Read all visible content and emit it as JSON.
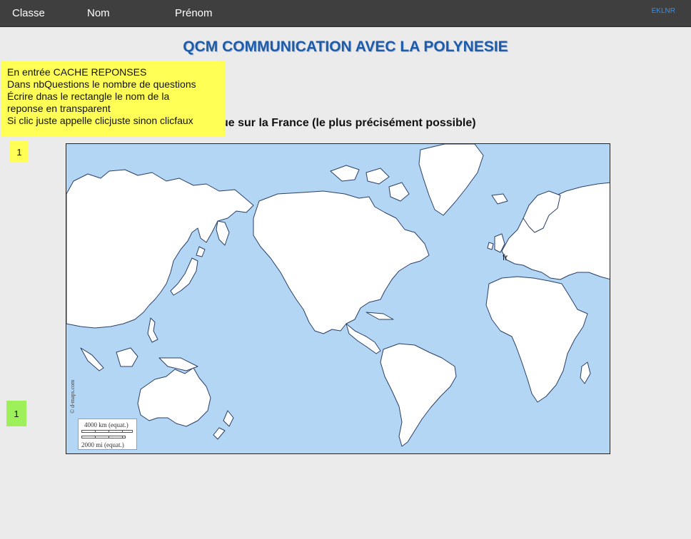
{
  "header": {
    "fields": [
      "Classe",
      "Nom",
      "Prénom"
    ],
    "code": "EKLNR"
  },
  "title": "QCM COMMUNICATION AVEC LA POLYNESIE",
  "note": {
    "lines": [
      "En entrée CACHE REPONSES",
      "Dans nbQuestions le nombre de questions",
      "Écrire dnas le rectangle le nom de la",
      "reponse en transparent",
      "Si clic juste appelle clicjuste sinon clicfaux"
    ]
  },
  "question": "ue sur la France (le plus précisément possible)",
  "counters": {
    "top": "1",
    "bottom": "1"
  },
  "map": {
    "label": "fr",
    "credit": "© d-maps.com",
    "scale_km": "4000 km (equat.)",
    "scale_mi": "2000 mi (equat.)",
    "colors": {
      "ocean": "#b3d6f4",
      "land": "#ffffff",
      "coast": "#2b3f66"
    }
  }
}
